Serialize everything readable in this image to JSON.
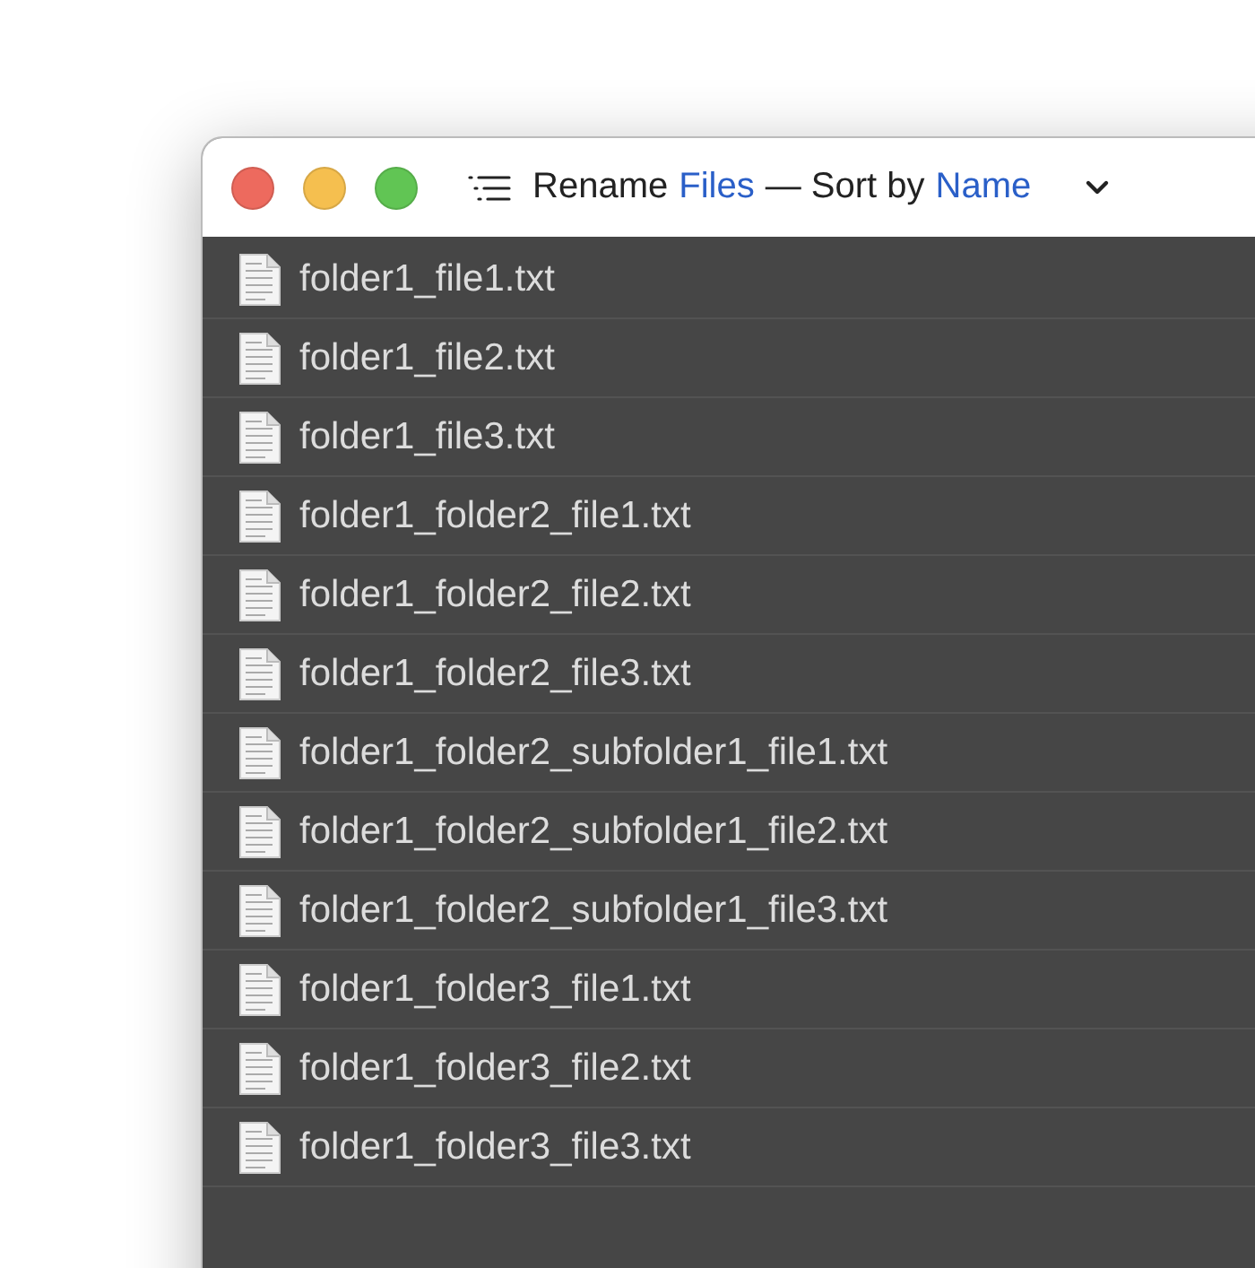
{
  "window": {
    "title": [
      {
        "text": "Rename",
        "highlight": false
      },
      {
        "text": "Files",
        "highlight": true
      },
      {
        "text": "— Sort by",
        "highlight": false
      },
      {
        "text": "Name",
        "highlight": true
      }
    ]
  },
  "files": [
    {
      "name": "folder1_file1.txt"
    },
    {
      "name": "folder1_file2.txt"
    },
    {
      "name": "folder1_file3.txt"
    },
    {
      "name": "folder1_folder2_file1.txt"
    },
    {
      "name": "folder1_folder2_file2.txt"
    },
    {
      "name": "folder1_folder2_file3.txt"
    },
    {
      "name": "folder1_folder2_subfolder1_file1.txt"
    },
    {
      "name": "folder1_folder2_subfolder1_file2.txt"
    },
    {
      "name": "folder1_folder2_subfolder1_file3.txt"
    },
    {
      "name": "folder1_folder3_file1.txt"
    },
    {
      "name": "folder1_folder3_file2.txt"
    },
    {
      "name": "folder1_folder3_file3.txt"
    }
  ]
}
